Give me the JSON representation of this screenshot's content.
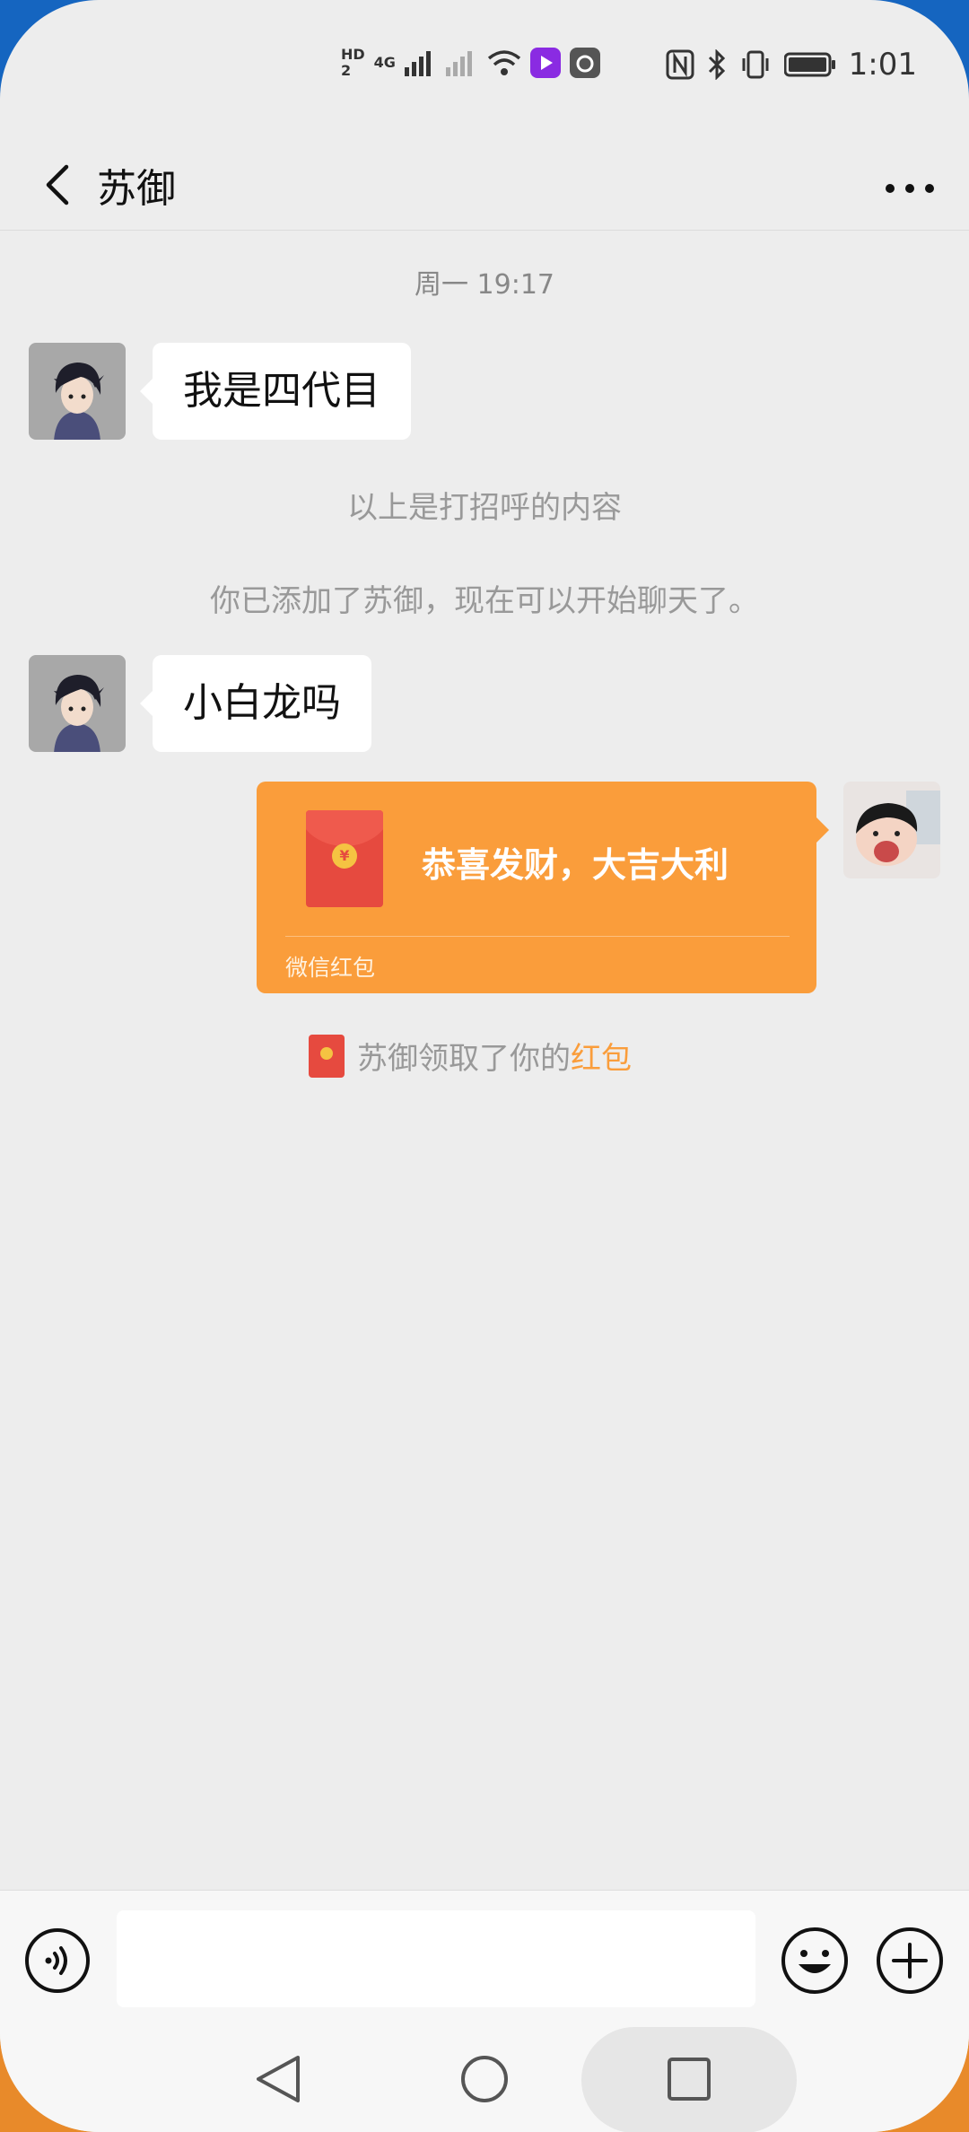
{
  "status_bar": {
    "hd_label": "HD",
    "sim1": "1",
    "sim2": "2",
    "network": "4G",
    "time": "1:01",
    "icons": [
      "signal-icon",
      "wifi-icon",
      "video-app-icon",
      "sina-icon",
      "nfc-icon",
      "bluetooth-icon",
      "vibrate-icon",
      "battery-icon"
    ]
  },
  "header": {
    "title": "苏御",
    "back_icon": "chevron-left-icon",
    "more_icon": "more-dots-icon"
  },
  "chat": {
    "time_divider": "周一 19:17",
    "messages": [
      {
        "from": "contact",
        "text": "我是四代目"
      },
      {
        "from": "contact",
        "text": "小白龙吗"
      }
    ],
    "system_messages": [
      "以上是打招呼的内容",
      "你已添加了苏御，现在可以开始聊天了。"
    ],
    "red_packet": {
      "greeting": "恭喜发财，大吉大利",
      "footer": "微信红包",
      "coin_symbol": "¥"
    },
    "red_packet_notice": {
      "prefix": "苏御领取了你的",
      "highlight": "红包"
    }
  },
  "input_bar": {
    "value": "",
    "voice_icon": "voice-icon",
    "emoji_icon": "emoji-icon",
    "plus_icon": "plus-icon"
  },
  "colors": {
    "background": "#ededed",
    "red_packet": "#fa9d3b",
    "envelope": "#e64a3f",
    "highlight": "#fa9d3b"
  }
}
